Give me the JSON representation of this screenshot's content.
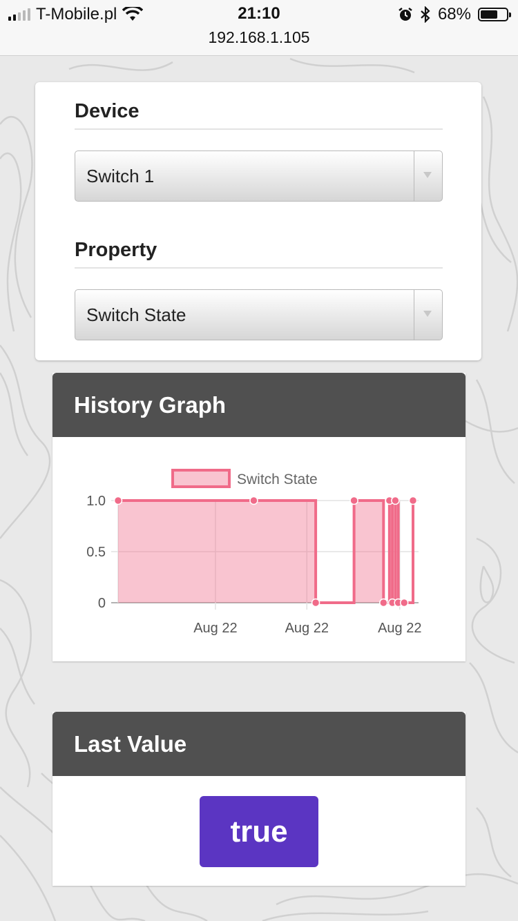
{
  "status_bar": {
    "carrier": "T-Mobile.pl",
    "time": "21:10",
    "url": "192.168.1.105",
    "battery_percent": "68%",
    "battery_level": 0.68,
    "signal_bars": 2,
    "icons": [
      "signal-icon",
      "wifi-icon",
      "alarm-icon",
      "bluetooth-icon",
      "battery-icon"
    ]
  },
  "form": {
    "device_label": "Device",
    "device_selected": "Switch 1",
    "property_label": "Property",
    "property_selected": "Switch State"
  },
  "history": {
    "title": "History Graph"
  },
  "chart_data": {
    "type": "line",
    "stepped": true,
    "filled": true,
    "legend": {
      "position": "top",
      "entries": [
        "Switch State"
      ]
    },
    "series": [
      {
        "name": "Switch State",
        "color": "#f06b89",
        "fill": "rgba(240,107,137,0.4)",
        "points": [
          {
            "x": 0,
            "y": 1
          },
          {
            "x": 0.46,
            "y": 1
          },
          {
            "x": 0.67,
            "y": 0
          },
          {
            "x": 0.8,
            "y": 1
          },
          {
            "x": 0.9,
            "y": 0
          },
          {
            "x": 0.92,
            "y": 1
          },
          {
            "x": 0.93,
            "y": 0
          },
          {
            "x": 0.94,
            "y": 1
          },
          {
            "x": 0.95,
            "y": 0
          },
          {
            "x": 0.97,
            "y": 0
          },
          {
            "x": 1.0,
            "y": 1
          }
        ]
      }
    ],
    "y_ticks": [
      "1.0",
      "0.5",
      "0"
    ],
    "x_ticks": [
      "Aug 22",
      "Aug 22",
      "Aug 22"
    ],
    "ylim": [
      0,
      1
    ],
    "grid": true
  },
  "last_value": {
    "title": "Last Value",
    "value": "true",
    "badge_color": "#5b35c2"
  }
}
